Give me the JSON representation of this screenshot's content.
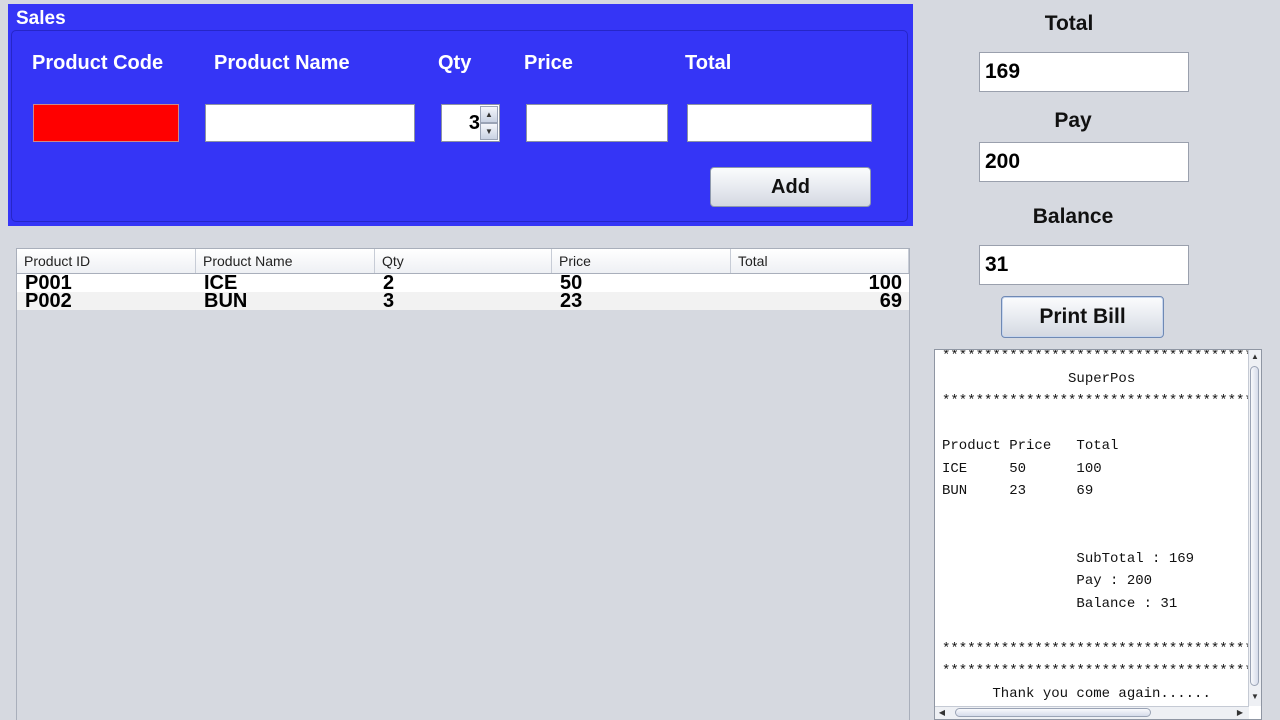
{
  "sales": {
    "title": "Sales",
    "labels": {
      "product_code": "Product Code",
      "product_name": "Product Name",
      "qty": "Qty",
      "price": "Price",
      "total": "Total"
    },
    "inputs": {
      "product_code": "",
      "product_name": "",
      "qty": "3",
      "price": "",
      "total": ""
    },
    "add_label": "Add",
    "product_code_color": "#ff0000",
    "panel_color": "#3535f6"
  },
  "table": {
    "columns": [
      "Product ID",
      "Product Name",
      "Qty",
      "Price",
      "Total"
    ],
    "rows": [
      [
        "P001",
        "ICE",
        "2",
        "50",
        "100"
      ],
      [
        "P002",
        "BUN",
        "3",
        "23",
        "69"
      ]
    ]
  },
  "summary": {
    "total_label": "Total",
    "total_value": "169",
    "pay_label": "Pay",
    "pay_value": "200",
    "balance_label": "Balance",
    "balance_value": "31",
    "print_label": "Print Bill"
  },
  "receipt": {
    "text": "*************************************************\n               SuperPos\n*************************************************\n\nProduct Price   Total\nICE     50      100\nBUN     23      69\n\n\n                SubTotal : 169\n                Pay : 200\n                Balance : 31\n\n*************************************************\n*************************************************\n      Thank you come again......"
  }
}
